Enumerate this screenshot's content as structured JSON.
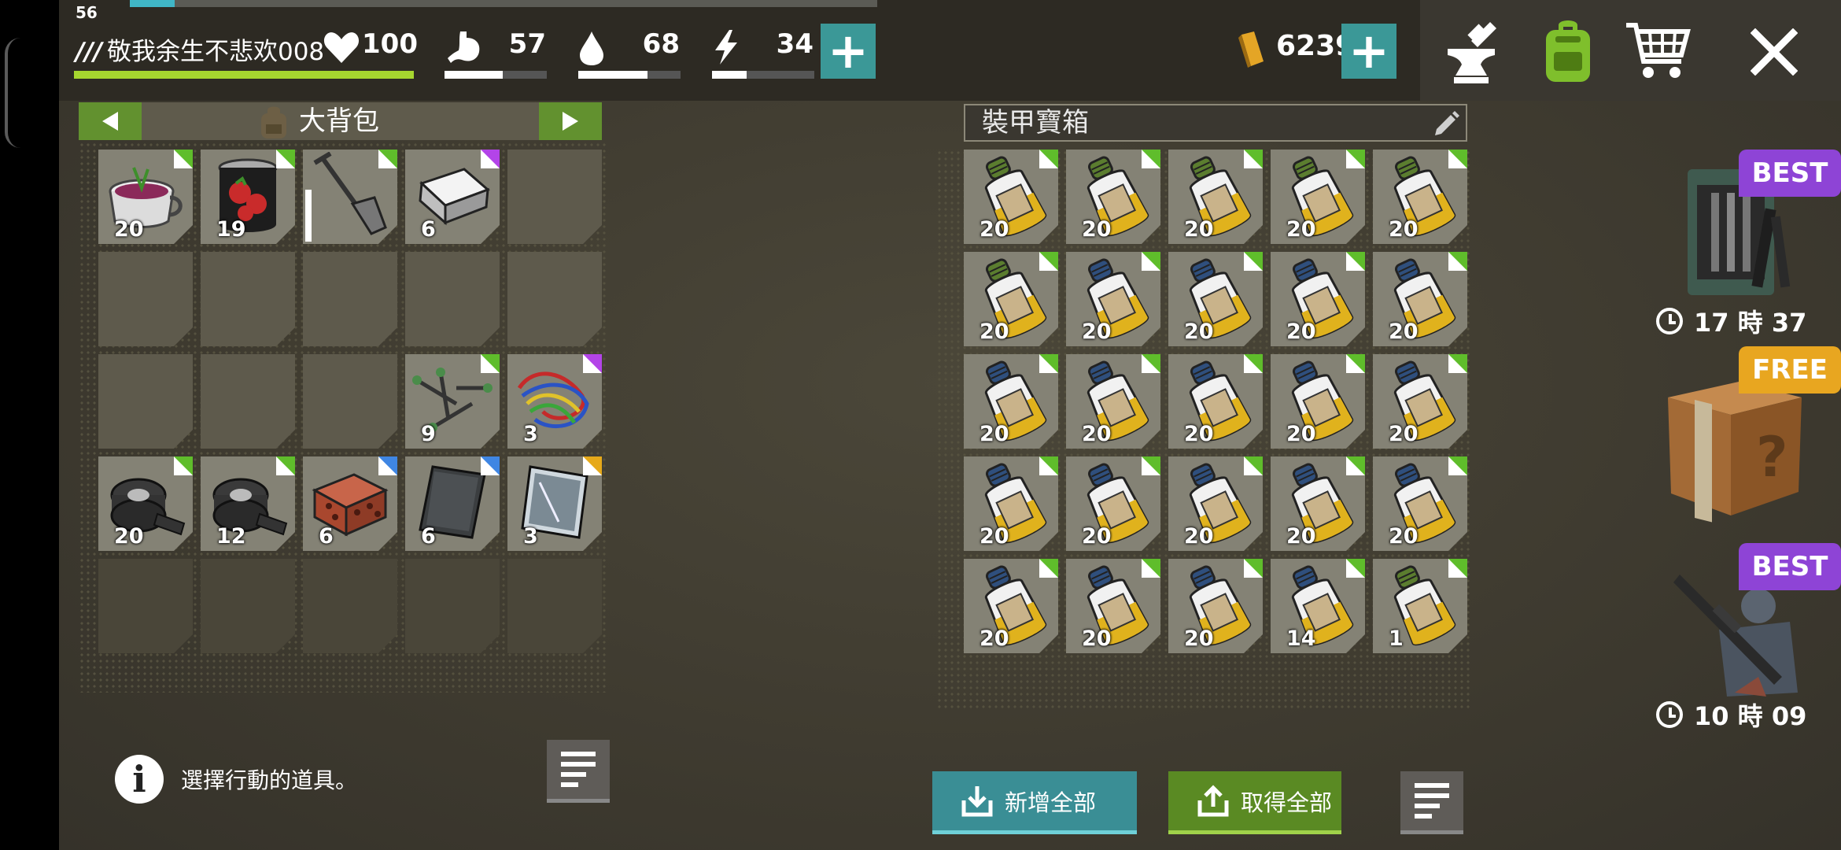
{
  "player": {
    "level": "56",
    "name": "敬我余生不悲欢008",
    "health": "100",
    "health_fraction": 1.0
  },
  "stats": [
    {
      "name": "food",
      "value": "57",
      "icon": "stomach-icon",
      "fraction": 0.57
    },
    {
      "name": "water",
      "value": "68",
      "icon": "water-drop-icon",
      "fraction": 0.68
    },
    {
      "name": "energy",
      "value": "34",
      "icon": "lightning-icon",
      "fraction": 0.34
    }
  ],
  "xp_fraction": 0.06,
  "gold": "6239",
  "top_icons": [
    "anvil-icon",
    "backpack-icon",
    "cart-icon",
    "close-icon"
  ],
  "backpack": {
    "title": "大背包",
    "slots": [
      {
        "item": "bowl-of-berries",
        "count": "20",
        "rarity": "#5fbd2b"
      },
      {
        "item": "canned-tomatoes",
        "count": "19",
        "rarity": "#5fbd2b"
      },
      {
        "item": "shovel",
        "count": "",
        "rarity": "#5fbd2b",
        "durability": 0.55
      },
      {
        "item": "iron-ingot",
        "count": "6",
        "rarity": "#b344e8"
      },
      {
        "item": "",
        "count": ""
      },
      {
        "item": "",
        "count": ""
      },
      {
        "item": "",
        "count": ""
      },
      {
        "item": "",
        "count": ""
      },
      {
        "item": "",
        "count": ""
      },
      {
        "item": "",
        "count": ""
      },
      {
        "item": "",
        "count": ""
      },
      {
        "item": "",
        "count": ""
      },
      {
        "item": "",
        "count": ""
      },
      {
        "item": "nails",
        "count": "9",
        "rarity": "#5fbd2b"
      },
      {
        "item": "wires",
        "count": "3",
        "rarity": "#b344e8"
      },
      {
        "item": "duct-tape",
        "count": "20",
        "rarity": "#5fbd2b"
      },
      {
        "item": "duct-tape",
        "count": "12",
        "rarity": "#5fbd2b"
      },
      {
        "item": "brick",
        "count": "6",
        "rarity": "#3f86e3"
      },
      {
        "item": "slate",
        "count": "6",
        "rarity": "#3f86e3"
      },
      {
        "item": "glass-sheet",
        "count": "3",
        "rarity": "#e6a91a"
      }
    ]
  },
  "chest": {
    "title": "裝甲寶箱",
    "slots": [
      {
        "item": "fuel-bottle-green",
        "count": "20"
      },
      {
        "item": "fuel-bottle-green",
        "count": "20"
      },
      {
        "item": "fuel-bottle-green",
        "count": "20"
      },
      {
        "item": "fuel-bottle-green",
        "count": "20"
      },
      {
        "item": "fuel-bottle-green",
        "count": "20"
      },
      {
        "item": "fuel-bottle-green",
        "count": "20"
      },
      {
        "item": "fuel-bottle-blue",
        "count": "20"
      },
      {
        "item": "fuel-bottle-blue",
        "count": "20"
      },
      {
        "item": "fuel-bottle-blue",
        "count": "20"
      },
      {
        "item": "fuel-bottle-blue",
        "count": "20"
      },
      {
        "item": "fuel-bottle-blue",
        "count": "20"
      },
      {
        "item": "fuel-bottle-blue",
        "count": "20"
      },
      {
        "item": "fuel-bottle-blue",
        "count": "20"
      },
      {
        "item": "fuel-bottle-blue",
        "count": "20"
      },
      {
        "item": "fuel-bottle-blue",
        "count": "20"
      },
      {
        "item": "fuel-bottle-blue",
        "count": "20"
      },
      {
        "item": "fuel-bottle-blue",
        "count": "20"
      },
      {
        "item": "fuel-bottle-blue",
        "count": "20"
      },
      {
        "item": "fuel-bottle-blue",
        "count": "20"
      },
      {
        "item": "fuel-bottle-blue",
        "count": "20"
      },
      {
        "item": "fuel-bottle-blue",
        "count": "20"
      },
      {
        "item": "fuel-bottle-blue",
        "count": "20"
      },
      {
        "item": "fuel-bottle-blue",
        "count": "20"
      },
      {
        "item": "fuel-bottle-blue",
        "count": "14"
      },
      {
        "item": "fuel-bottle-green",
        "count": "1"
      }
    ],
    "rarity": "#5fbd2b"
  },
  "info_text": "選擇行動的道具。",
  "buttons": {
    "add_all": "新增全部",
    "take_all": "取得全部"
  },
  "offers": [
    {
      "badge": "BEST",
      "badge_color": "#8e44d6",
      "timer": "17 時 37",
      "item": "weapon-rack"
    },
    {
      "badge": "FREE",
      "badge_color": "#e8a620",
      "timer": "",
      "item": "mystery-box"
    },
    {
      "badge": "BEST",
      "badge_color": "#8e44d6",
      "timer": "10 時 09",
      "item": "soldier-with-rifle"
    }
  ]
}
